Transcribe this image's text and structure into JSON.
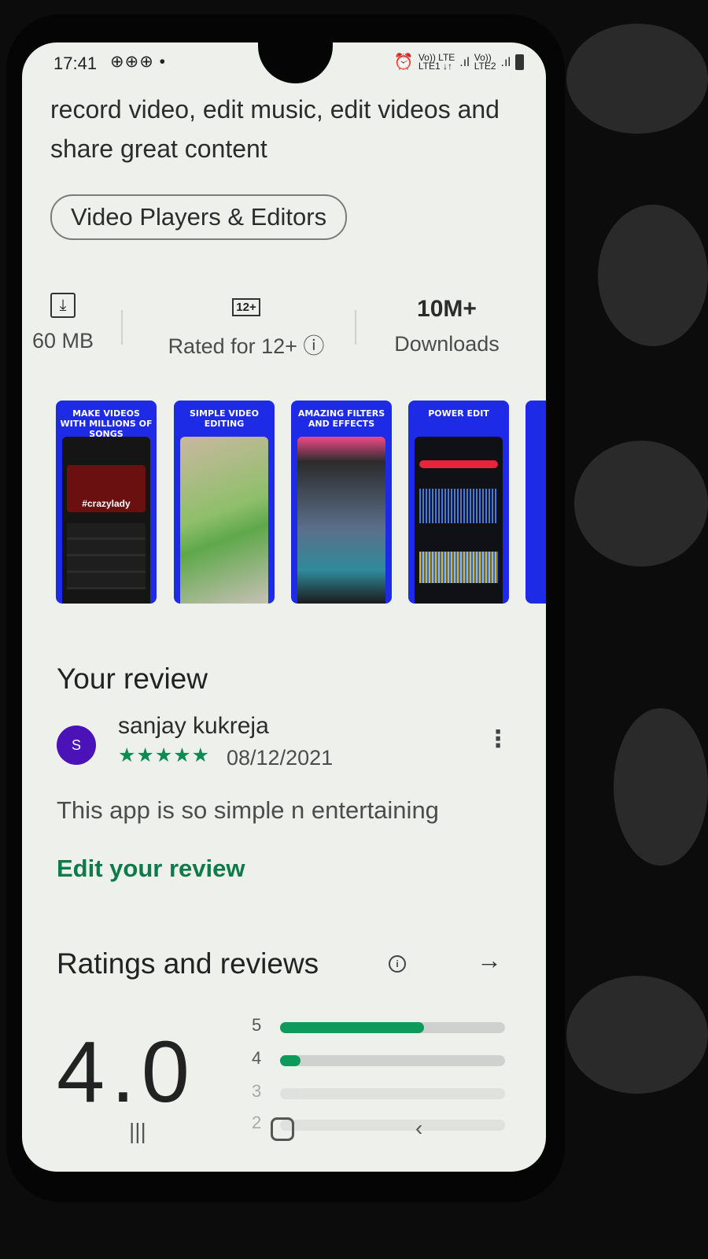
{
  "status_bar": {
    "time": "17:41",
    "notification_icons": "⊕⊕⊕ •",
    "sim1_top": "Vo)) LTE",
    "sim1_bottom": "LTE1 ↓↑",
    "sim2_top": "Vo))",
    "sim2_bottom": "LTE2"
  },
  "app_info": {
    "description": "record video, edit music, edit videos and share great content",
    "category_chip": "Video Players & Editors",
    "size_label": "60 MB",
    "rating_badge": "12+",
    "rated_label": "Rated for 12+ ⓘ",
    "downloads_value": "10M+",
    "downloads_label": "Downloads"
  },
  "screenshots": [
    {
      "title": "MAKE VIDEOS WITH MILLIONS OF SONGS",
      "tag": "#crazylady"
    },
    {
      "title": "SIMPLE VIDEO EDITING"
    },
    {
      "title": "AMAZING FILTERS AND EFFECTS"
    },
    {
      "title": "POWER EDIT"
    }
  ],
  "your_review": {
    "heading": "Your review",
    "avatar_letter": "S",
    "reviewer_name": "sanjay kukreja",
    "stars": "★★★★★",
    "date": "08/12/2021",
    "text": "This app is so simple n entertaining",
    "edit_link": "Edit your review"
  },
  "ratings": {
    "heading": "Ratings and reviews",
    "average": "4.0",
    "bars": [
      {
        "label": "5",
        "fraction": 0.64
      },
      {
        "label": "4",
        "fraction": 0.09
      },
      {
        "label": "3",
        "fraction": 0.0
      },
      {
        "label": "2",
        "fraction": 0.0
      }
    ]
  },
  "colors": {
    "accent_green": "#0e8a53",
    "avatar_purple": "#4b12b8",
    "screenshot_blue": "#1d2be6"
  },
  "nav_bar": {
    "recents_icon": "recents-icon",
    "home_icon": "home-icon",
    "back_icon": "back-icon"
  }
}
